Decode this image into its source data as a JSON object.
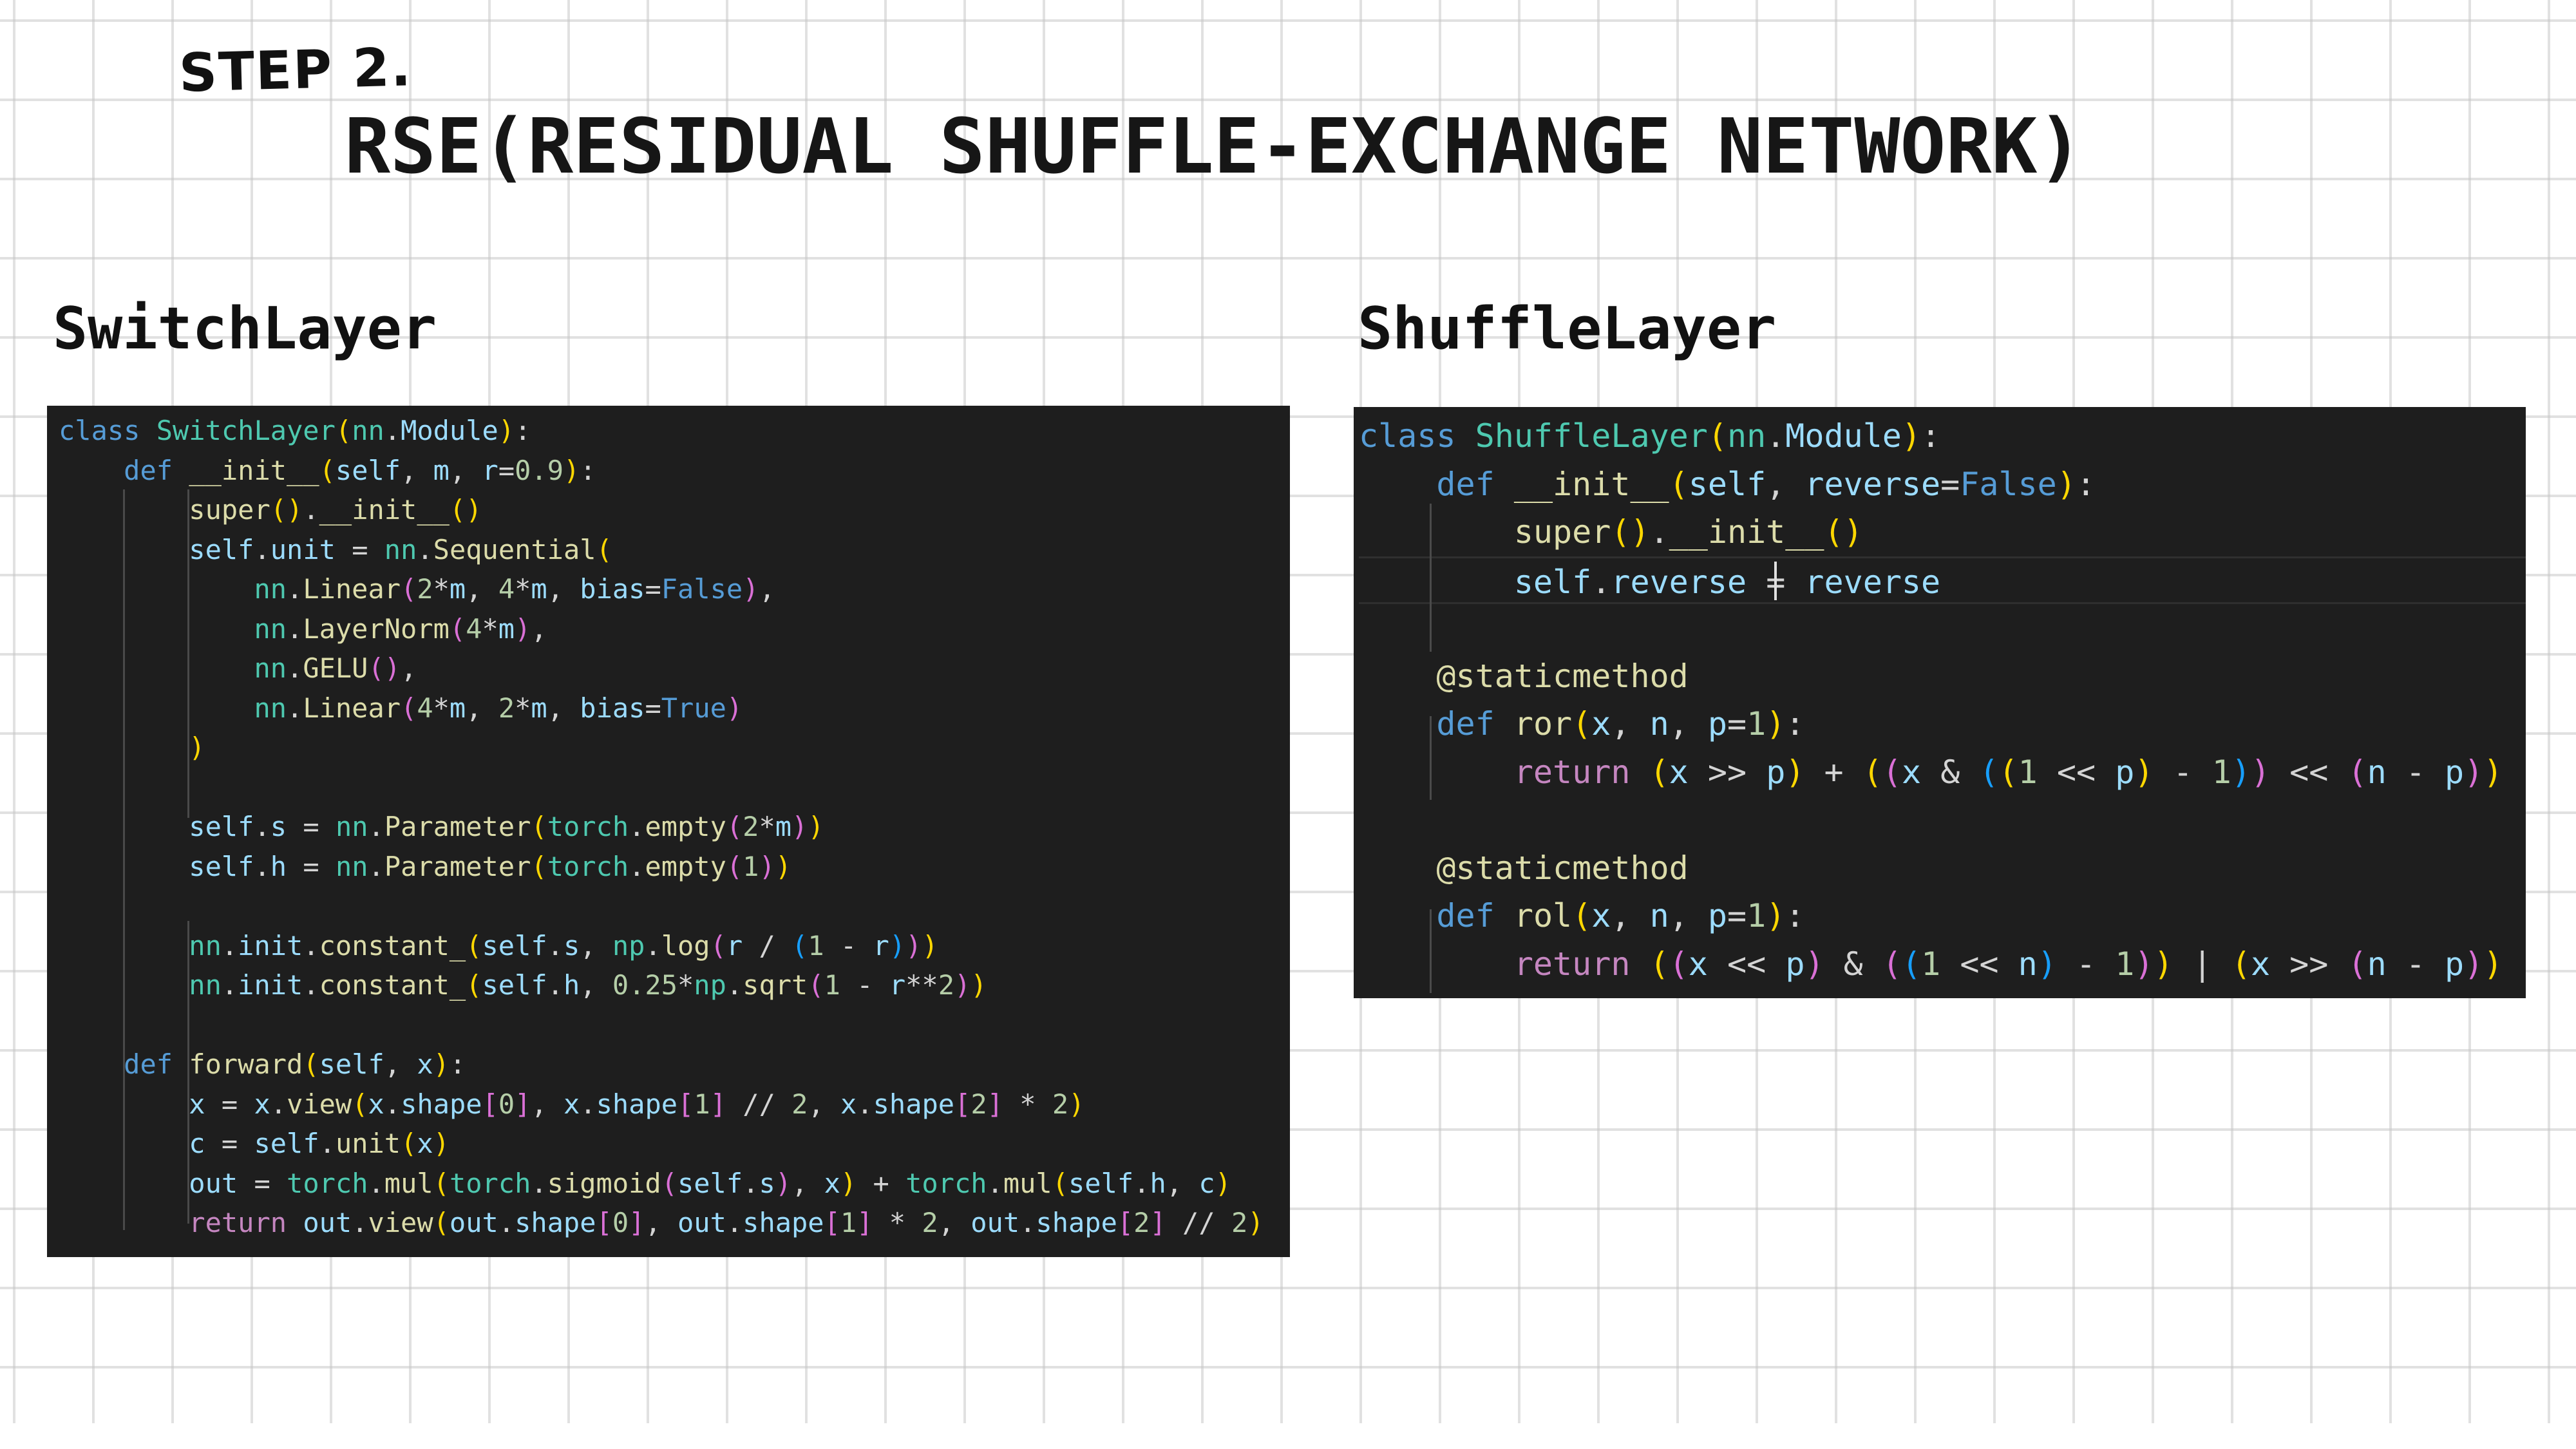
{
  "slide": {
    "step_label": "STEP 2.",
    "title": "RSE(RESIDUAL SHUFFLE-EXCHANGE NETWORK)"
  },
  "left_section": {
    "title": "SwitchLayer",
    "code_lines": [
      "class SwitchLayer(nn.Module):",
      "    def __init__(self, m, r=0.9):",
      "        super().__init__()",
      "        self.unit = nn.Sequential(",
      "            nn.Linear(2*m, 4*m, bias=False),",
      "            nn.LayerNorm(4*m),",
      "            nn.GELU(),",
      "            nn.Linear(4*m, 2*m, bias=True)",
      "        )",
      "",
      "        self.s = nn.Parameter(torch.empty(2*m))",
      "        self.h = nn.Parameter(torch.empty(1))",
      "",
      "        nn.init.constant_(self.s, np.log(r / (1 - r)))",
      "        nn.init.constant_(self.h, 0.25*np.sqrt(1 - r**2))",
      "",
      "    def forward(self, x):",
      "        x = x.view(x.shape[0], x.shape[1] // 2, x.shape[2] * 2)",
      "        c = self.unit(x)",
      "        out = torch.mul(torch.sigmoid(self.s), x) + torch.mul(self.h, c)",
      "        return out.view(out.shape[0], out.shape[1] * 2, out.shape[2] // 2)"
    ]
  },
  "right_section": {
    "title": "ShuffleLayer",
    "code_lines": [
      "class ShuffleLayer(nn.Module):",
      "    def __init__(self, reverse=False):",
      "        super().__init__()",
      "        self.reverse = reverse",
      "",
      "    @staticmethod",
      "    def ror(x, n, p=1):",
      "        return (x >> p) + ((x & ((1 << p) - 1)) << (n - p))",
      "",
      "    @staticmethod",
      "    def rol(x, n, p=1):",
      "        return ((x << p) & ((1 << n) - 1)) | (x >> (n - p))"
    ]
  },
  "theme": {
    "editor_background": "#1e1e1e",
    "keyword": "#569cd6",
    "control_keyword": "#c586c0",
    "class_name": "#4ec9b0",
    "function": "#dcdcaa",
    "variable": "#9cdcfe",
    "number": "#b5cea8",
    "bracket_level_1": "#ffd700",
    "bracket_level_2": "#da70d6",
    "bracket_level_3": "#179fff"
  }
}
